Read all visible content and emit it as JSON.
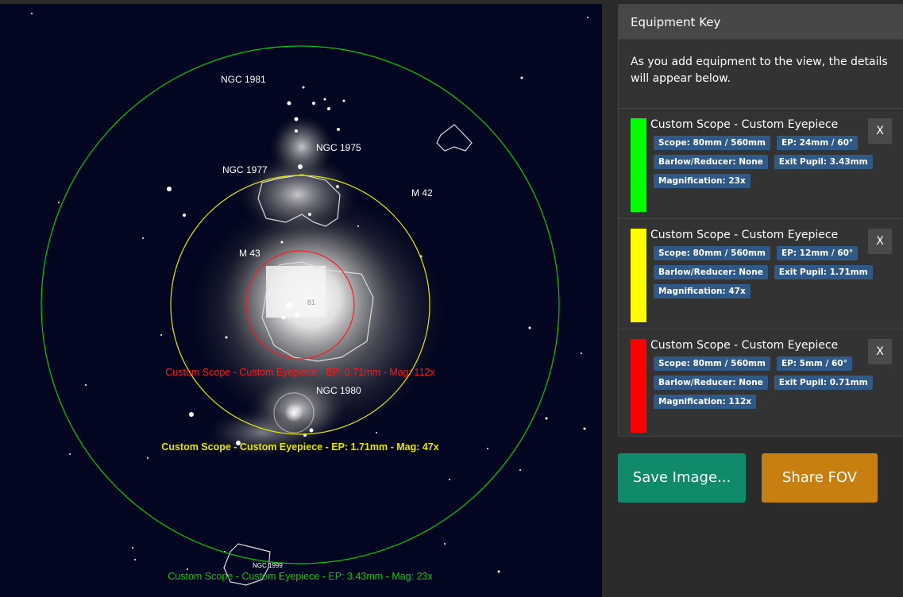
{
  "sky": {
    "labels": {
      "ngc1981": "NGC 1981",
      "ngc1975": "NGC 1975",
      "ngc1977": "NGC 1977",
      "m42": "M 42",
      "m43": "M 43",
      "ngc1980": "NGC 1980",
      "ngc1999": "NGC 1999",
      "n81": "81"
    },
    "fov_labels": {
      "red": "Custom Scope - Custom Eyepiece - EP: 0.71mm - Mag: 112x",
      "yellow": "Custom Scope - Custom Eyepiece - EP: 1.71mm - Mag: 47x",
      "green": "Custom Scope - Custom Eyepiece - EP: 3.43mm - Mag: 23x"
    },
    "colors": {
      "green": "#00cc00",
      "yellow": "#e6e600",
      "red": "#ff1a1a",
      "background": "#020620"
    }
  },
  "panel": {
    "title": "Equipment Key",
    "intro": "As you add equipment to the view, the details will appear below.",
    "items": [
      {
        "title": "Custom Scope - Custom Eyepiece",
        "color": "#00ff00",
        "scope": "Scope: 80mm / 560mm",
        "ep": "EP: 24mm / 60°",
        "barlow": "Barlow/Reducer: None",
        "exit": "Exit Pupil: 3.43mm",
        "mag": "Magnification: 23x",
        "close": "X"
      },
      {
        "title": "Custom Scope - Custom Eyepiece",
        "color": "#ffff00",
        "scope": "Scope: 80mm / 560mm",
        "ep": "EP: 12mm / 60°",
        "barlow": "Barlow/Reducer: None",
        "exit": "Exit Pupil: 1.71mm",
        "mag": "Magnification: 47x",
        "close": "X"
      },
      {
        "title": "Custom Scope - Custom Eyepiece",
        "color": "#ff0000",
        "scope": "Scope: 80mm / 560mm",
        "ep": "EP: 5mm / 60°",
        "barlow": "Barlow/Reducer: None",
        "exit": "Exit Pupil: 0.71mm",
        "mag": "Magnification: 112x",
        "close": "X"
      }
    ]
  },
  "buttons": {
    "save": "Save Image...",
    "share": "Share FOV"
  },
  "button_colors": {
    "save": "#0f8a6a",
    "share": "#c77f0f"
  }
}
